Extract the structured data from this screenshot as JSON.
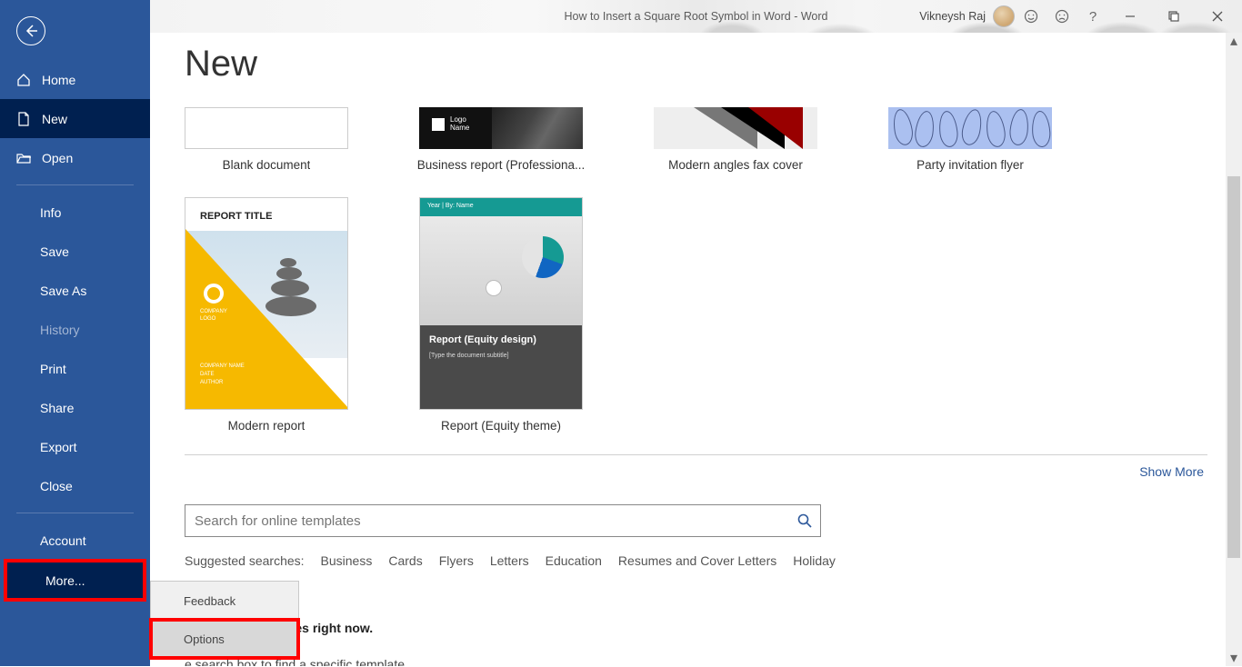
{
  "title": {
    "document": "How to Insert a Square Root Symbol in Word",
    "sep": " - ",
    "app": "Word"
  },
  "user": {
    "name": "Vikneysh Raj"
  },
  "sidebar": {
    "home": "Home",
    "new": "New",
    "open": "Open",
    "info": "Info",
    "save": "Save",
    "saveas": "Save As",
    "history": "History",
    "print": "Print",
    "share": "Share",
    "export": "Export",
    "close": "Close",
    "account": "Account",
    "more": "More..."
  },
  "flyout": {
    "feedback": "Feedback",
    "options": "Options"
  },
  "heading": "New",
  "templates": {
    "blank": "Blank document",
    "bizreport": "Business report (Professiona...",
    "fax": "Modern angles fax cover",
    "party": "Party invitation flyer",
    "modern": "Modern report",
    "equity": "Report (Equity theme)"
  },
  "thumbtext": {
    "biz_logo": "Logo\nName",
    "modern_title": "REPORT TITLE",
    "modern_clogo": "COMPANY\nLOGO",
    "modern_bottom": "COMPANY NAME\nDATE\nAUTHOR",
    "equity_bar": "Year | By: Name",
    "equity_title": "Report (Equity design)",
    "equity_sub": "[Type the document subtitle]"
  },
  "showmore": "Show More",
  "search": {
    "placeholder": "Search for online templates"
  },
  "suggested": {
    "label": "Suggested searches:",
    "items": [
      "Business",
      "Cards",
      "Flyers",
      "Letters",
      "Education",
      "Resumes and Cover Letters",
      "Holiday"
    ]
  },
  "notemplates": {
    "bold": "any Office templates right now.",
    "sub": "e search box to find a specific template."
  }
}
